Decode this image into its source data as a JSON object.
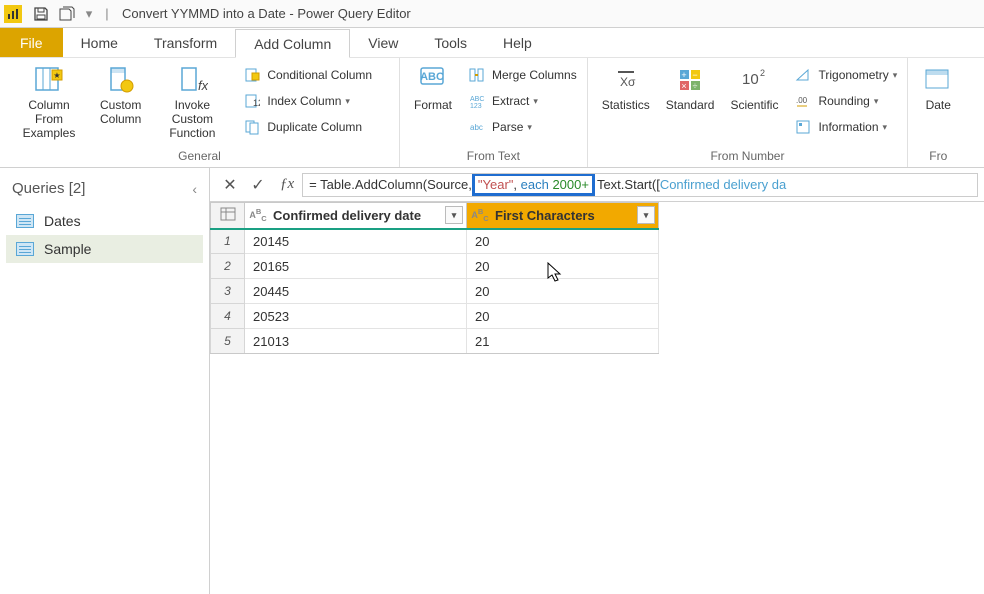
{
  "window": {
    "title": "Convert YYMMD into a Date - Power Query Editor",
    "qat_dropdown": "▾"
  },
  "menu": {
    "file": "File",
    "home": "Home",
    "transform": "Transform",
    "addcolumn": "Add Column",
    "view": "View",
    "tools": "Tools",
    "help": "Help"
  },
  "ribbon": {
    "general": {
      "label": "General",
      "column_from_examples": "Column From\nExamples",
      "custom_column": "Custom\nColumn",
      "invoke_custom_function": "Invoke Custom\nFunction",
      "conditional_column": "Conditional Column",
      "index_column": "Index Column",
      "duplicate_column": "Duplicate Column"
    },
    "fromtext": {
      "label": "From Text",
      "format": "Format",
      "merge_columns": "Merge Columns",
      "extract": "Extract",
      "parse": "Parse"
    },
    "fromnumber": {
      "label": "From Number",
      "statistics": "Statistics",
      "standard": "Standard",
      "scientific": "Scientific",
      "trigonometry": "Trigonometry",
      "rounding": "Rounding",
      "information": "Information"
    },
    "fromdate": {
      "label": "Fro",
      "date": "Date"
    }
  },
  "queries": {
    "header": "Queries [2]",
    "items": [
      {
        "name": "Dates"
      },
      {
        "name": "Sample"
      }
    ]
  },
  "formula": {
    "pre": "= Table.AddColumn(Source, ",
    "highlight_year": "\"Year\"",
    "highlight_sep": ", ",
    "highlight_each": "each ",
    "highlight_num": "2000+",
    "post_prefix": "Text.Start([",
    "post_ident": "Confirmed delivery da"
  },
  "grid": {
    "columns": [
      {
        "type": "ABC",
        "label": "Confirmed delivery date"
      },
      {
        "type": "ABC",
        "label": "First Characters"
      }
    ],
    "rows": [
      {
        "n": "1",
        "c1": "20145",
        "c2": "20"
      },
      {
        "n": "2",
        "c1": "20165",
        "c2": "20"
      },
      {
        "n": "3",
        "c1": "20445",
        "c2": "20"
      },
      {
        "n": "4",
        "c1": "20523",
        "c2": "20"
      },
      {
        "n": "5",
        "c1": "21013",
        "c2": "21"
      }
    ]
  },
  "chart_data": {
    "type": "table",
    "columns": [
      "Confirmed delivery date",
      "First Characters"
    ],
    "rows": [
      [
        "20145",
        "20"
      ],
      [
        "20165",
        "20"
      ],
      [
        "20445",
        "20"
      ],
      [
        "20523",
        "20"
      ],
      [
        "21013",
        "21"
      ]
    ]
  }
}
